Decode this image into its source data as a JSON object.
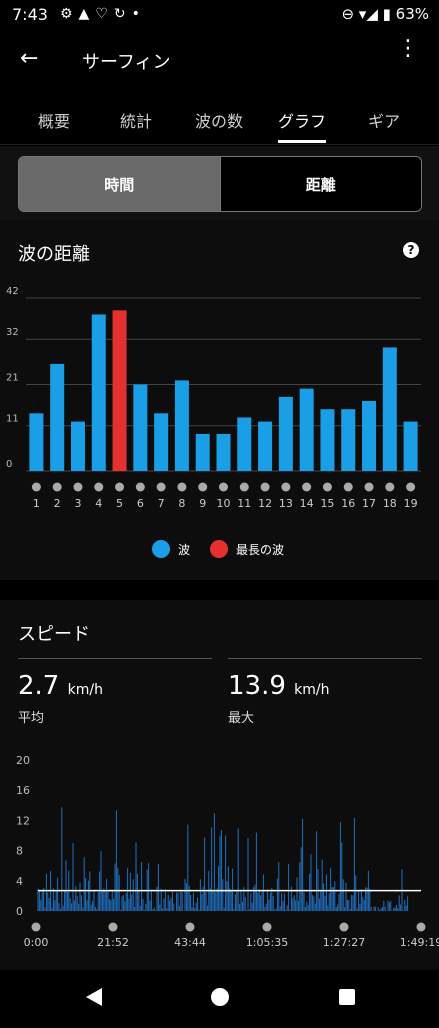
{
  "status": {
    "time": "7:43",
    "battery": "63%"
  },
  "appbar": {
    "title": "サーフィン"
  },
  "tabs": [
    "概要",
    "統計",
    "波の数",
    "グラフ",
    "ギア"
  ],
  "segment": {
    "left": "時間",
    "right": "距離"
  },
  "distance_card": {
    "title": "波の距離",
    "help": "?"
  },
  "legend": {
    "wave": "波",
    "longest": "最長の波"
  },
  "colors": {
    "bar": "#1a9ee6",
    "longest": "#e53030",
    "speedline": "#ffffff"
  },
  "chart_data": [
    {
      "type": "bar",
      "title": "波の距離",
      "categories": [
        "1",
        "2",
        "3",
        "4",
        "5",
        "6",
        "7",
        "8",
        "9",
        "10",
        "11",
        "12",
        "13",
        "14",
        "15",
        "16",
        "17",
        "18",
        "19"
      ],
      "values": [
        14,
        26,
        12,
        38,
        39,
        21,
        14,
        22,
        9,
        9,
        13,
        12,
        18,
        20,
        15,
        15,
        17,
        30,
        12
      ],
      "highlight_index": 4,
      "yticks": [
        0,
        11,
        21,
        32,
        42
      ],
      "ylim": [
        0,
        42
      ]
    },
    {
      "type": "bar",
      "title": "スピード",
      "xticks": [
        "0:00",
        "21:52",
        "43:44",
        "1:05:35",
        "1:27:27",
        "1:49:19"
      ],
      "yticks": [
        0,
        4,
        8,
        12,
        16,
        20
      ],
      "ylim": [
        0,
        20
      ],
      "average": 2.7
    }
  ],
  "speed": {
    "title": "スピード",
    "avg_value": "2.7",
    "avg_unit": "km/h",
    "avg_label": "平均",
    "max_value": "13.9",
    "max_unit": "km/h",
    "max_label": "最大"
  }
}
